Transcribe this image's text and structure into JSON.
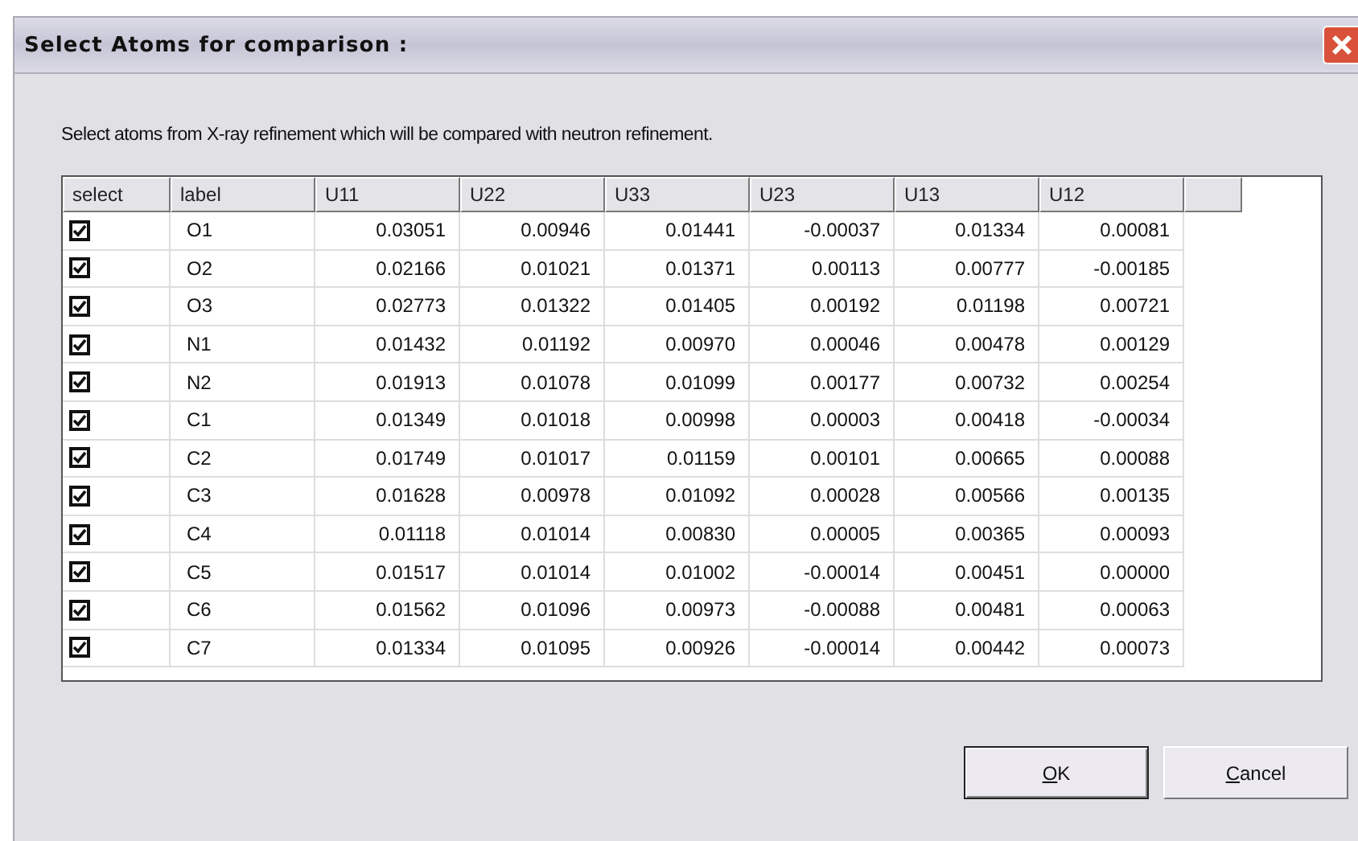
{
  "window": {
    "title": "Select Atoms for comparison :"
  },
  "instruction": "Select atoms from X-ray refinement which will be compared with neutron refinement.",
  "table": {
    "columns": [
      "select",
      "label",
      "U11",
      "U22",
      "U33",
      "U23",
      "U13",
      "U12"
    ],
    "rows": [
      {
        "checked": true,
        "label": "O1",
        "values": [
          "0.03051",
          "0.00946",
          "0.01441",
          "-0.00037",
          "0.01334",
          "0.00081"
        ]
      },
      {
        "checked": true,
        "label": "O2",
        "values": [
          "0.02166",
          "0.01021",
          "0.01371",
          "0.00113",
          "0.00777",
          "-0.00185"
        ]
      },
      {
        "checked": true,
        "label": "O3",
        "values": [
          "0.02773",
          "0.01322",
          "0.01405",
          "0.00192",
          "0.01198",
          "0.00721"
        ]
      },
      {
        "checked": true,
        "label": "N1",
        "values": [
          "0.01432",
          "0.01192",
          "0.00970",
          "0.00046",
          "0.00478",
          "0.00129"
        ]
      },
      {
        "checked": true,
        "label": "N2",
        "values": [
          "0.01913",
          "0.01078",
          "0.01099",
          "0.00177",
          "0.00732",
          "0.00254"
        ]
      },
      {
        "checked": true,
        "label": "C1",
        "values": [
          "0.01349",
          "0.01018",
          "0.00998",
          "0.00003",
          "0.00418",
          "-0.00034"
        ]
      },
      {
        "checked": true,
        "label": "C2",
        "values": [
          "0.01749",
          "0.01017",
          "0.01159",
          "0.00101",
          "0.00665",
          "0.00088"
        ]
      },
      {
        "checked": true,
        "label": "C3",
        "values": [
          "0.01628",
          "0.00978",
          "0.01092",
          "0.00028",
          "0.00566",
          "0.00135"
        ]
      },
      {
        "checked": true,
        "label": "C4",
        "values": [
          "0.01118",
          "0.01014",
          "0.00830",
          "0.00005",
          "0.00365",
          "0.00093"
        ]
      },
      {
        "checked": true,
        "label": "C5",
        "values": [
          "0.01517",
          "0.01014",
          "0.01002",
          "-0.00014",
          "0.00451",
          "0.00000"
        ]
      },
      {
        "checked": true,
        "label": "C6",
        "values": [
          "0.01562",
          "0.01096",
          "0.00973",
          "-0.00088",
          "0.00481",
          "0.00063"
        ]
      },
      {
        "checked": true,
        "label": "C7",
        "values": [
          "0.01334",
          "0.01095",
          "0.00926",
          "-0.00014",
          "0.00442",
          "0.00073"
        ]
      }
    ]
  },
  "buttons": [
    {
      "label": "OK",
      "default": true,
      "mnemonic_first": true
    },
    {
      "label": "Cancel",
      "default": false,
      "mnemonic_first": true
    }
  ]
}
